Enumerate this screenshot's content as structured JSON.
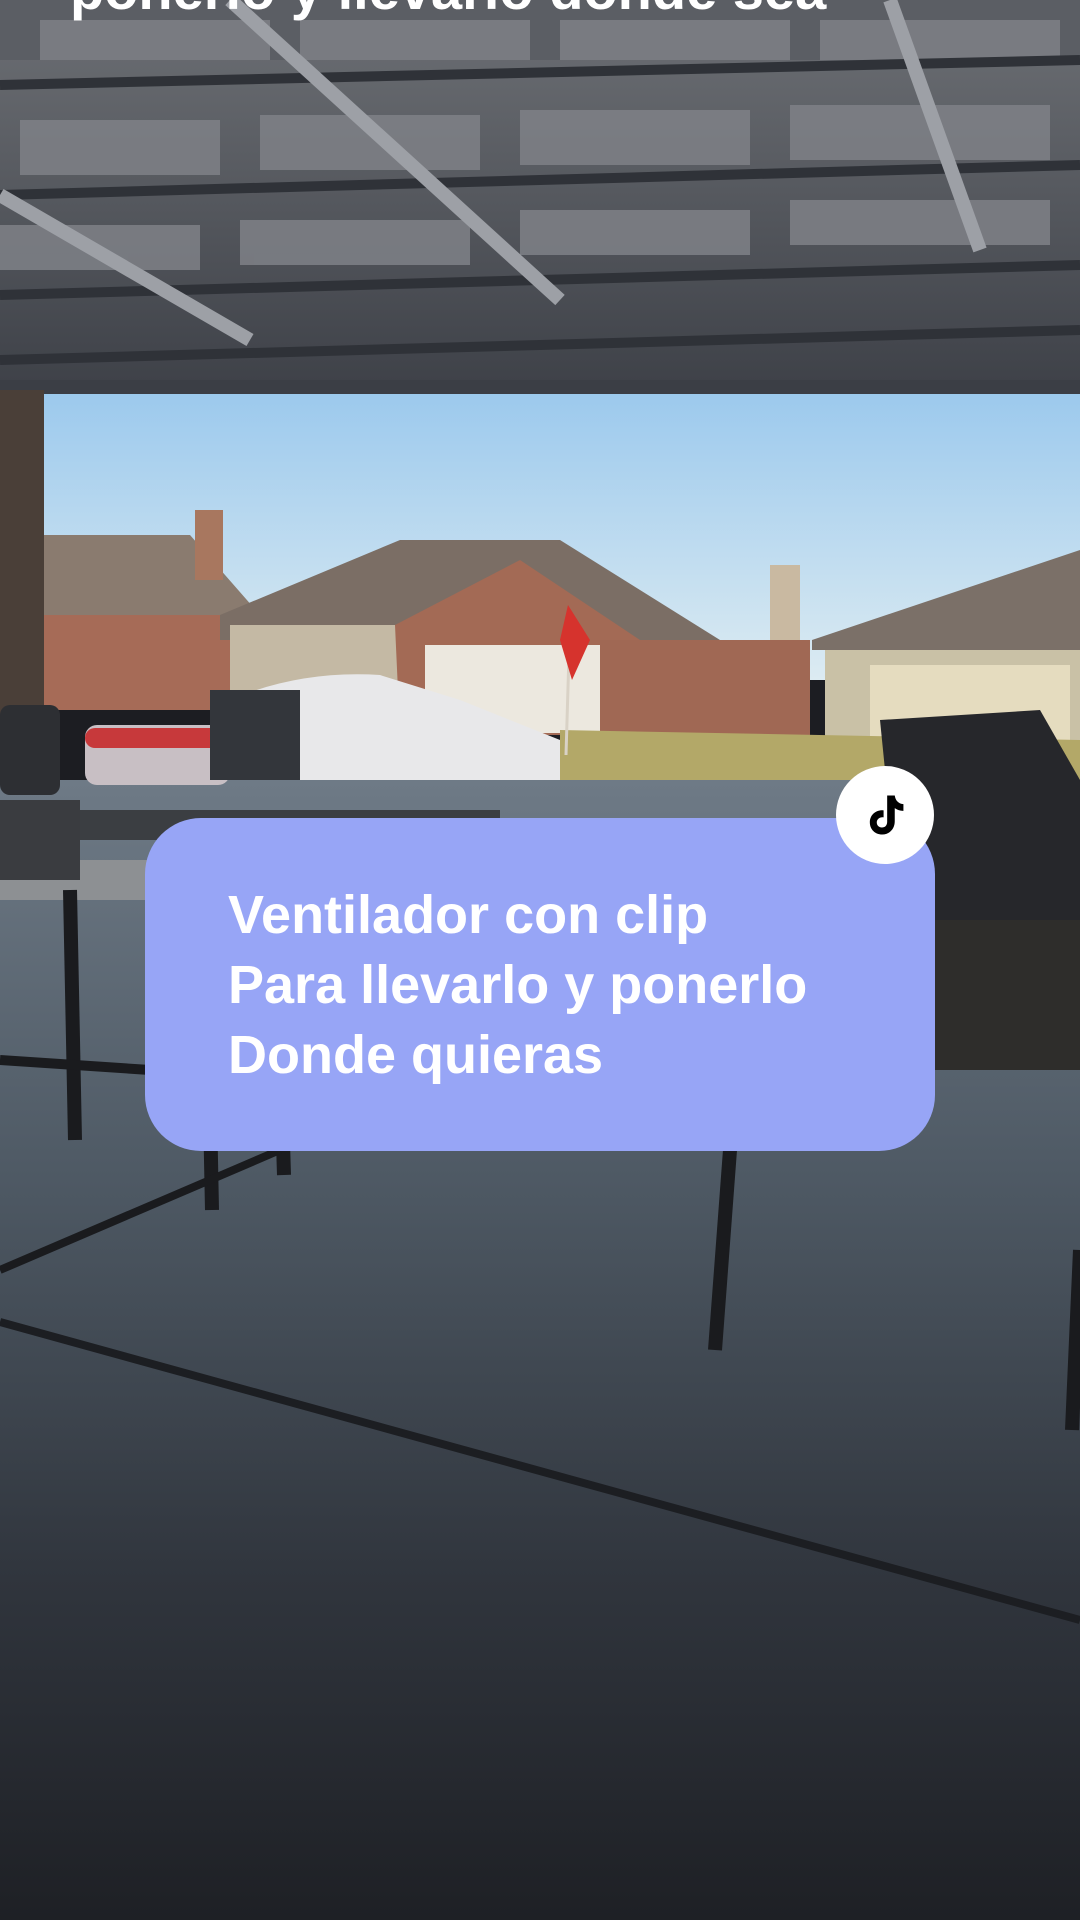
{
  "video": {
    "top_caption": "ponerlo y llevarlo donde sea",
    "caption_lines": [
      "Ventilador con clip",
      "Para llevarlo y ponerlo",
      "Donde quieras"
    ],
    "caption_card_color": "#97a5f6",
    "caption_text_color": "#ffffff",
    "badge_icon": "tiktok-logo-icon"
  }
}
